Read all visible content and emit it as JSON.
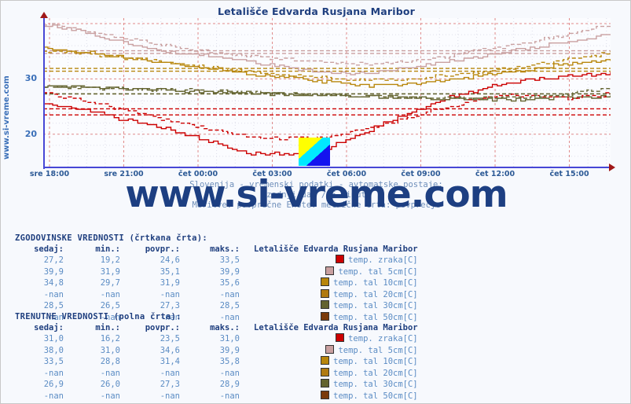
{
  "page": {
    "background": "#f7f9fd",
    "site_vertical_text": "www.si-vreme.com",
    "watermark": "www.si-vreme.com"
  },
  "chart_title": "Letališče Edvarda Rusjana Maribor",
  "subtitle": {
    "line1": "Slovenija - vremenski podatki - avtomatske postaje:",
    "line2": "zadnji dan / 5 minut",
    "line3": "Meritve: povprečne  Enote: metrične  Črta: povprečje"
  },
  "logo": {
    "name": "si-vreme-logo",
    "colors": [
      "#ffff00",
      "#00eaff",
      "#1414ef"
    ]
  },
  "chart_data": {
    "type": "line",
    "title": "Letališče Edvarda Rusjana Maribor",
    "xlabel": "",
    "ylabel": "",
    "ylim": [
      14,
      41
    ],
    "yticks": [
      20,
      30
    ],
    "grid": true,
    "legend_position": "bottom-table",
    "x": [
      "sre 18:00",
      "sre 21:00",
      "čet 00:00",
      "čet 03:00",
      "čet 06:00",
      "čet 09:00",
      "čet 12:00",
      "čet 15:00"
    ],
    "xtick_labels": [
      "sre 18:00",
      "sre 21:00",
      "čet 00:00",
      "čet 03:00",
      "čet 06:00",
      "čet 09:00",
      "čet 12:00",
      "čet 15:00"
    ],
    "series": [
      {
        "name": "temp. zraka[C]",
        "color": "#cc0000",
        "style": "solid",
        "group": "trenutne",
        "values": [
          25.8,
          24.4,
          22.6,
          21.0,
          19.0,
          16.6,
          16.4,
          17.6,
          20.6,
          23.8,
          26.6,
          28.6,
          30.0,
          30.6,
          31.0
        ]
      },
      {
        "name": "temp. tal  5cm[C]",
        "color": "#c9a0a0",
        "style": "solid",
        "group": "trenutne",
        "values": [
          39.8,
          38.4,
          36.6,
          35.0,
          34.2,
          33.2,
          32.0,
          31.2,
          31.0,
          32.0,
          33.2,
          34.4,
          35.6,
          36.8,
          38.0
        ]
      },
      {
        "name": "temp. tal 10cm[C]",
        "color": "#b8860b",
        "style": "solid",
        "group": "trenutne",
        "values": [
          35.6,
          34.8,
          34.0,
          33.0,
          32.0,
          31.0,
          30.2,
          29.4,
          28.8,
          29.0,
          29.8,
          30.8,
          31.8,
          32.8,
          33.5
        ]
      },
      {
        "name": "temp. tal 20cm[C]",
        "color": "#b07a10",
        "style": "solid",
        "group": "trenutne",
        "values": []
      },
      {
        "name": "temp. tal 30cm[C]",
        "color": "#63632f",
        "style": "solid",
        "group": "trenutne",
        "values": [
          28.6,
          28.6,
          28.4,
          28.0,
          27.6,
          27.4,
          27.2,
          27.0,
          26.8,
          26.6,
          26.4,
          26.3,
          26.4,
          26.6,
          26.9
        ]
      },
      {
        "name": "temp. tal 50cm[C]",
        "color": "#7a3a0a",
        "style": "solid",
        "group": "trenutne",
        "values": []
      },
      {
        "name": "temp. zraka[C] (zgodovinske)",
        "color": "#cc0000",
        "style": "dashed",
        "group": "zgodovinske",
        "values": [
          27.6,
          26.0,
          24.4,
          22.6,
          21.0,
          19.8,
          19.2,
          19.4,
          21.0,
          23.0,
          25.0,
          26.8,
          27.0,
          26.6,
          27.2
        ]
      },
      {
        "name": "temp. tal  5cm[C] (zgodovinske)",
        "color": "#c9a0a0",
        "style": "dashed",
        "group": "zgodovinske",
        "values": [
          39.9,
          38.8,
          37.4,
          36.0,
          35.0,
          34.2,
          33.6,
          33.0,
          32.6,
          33.2,
          34.2,
          35.4,
          36.6,
          38.2,
          39.9
        ]
      },
      {
        "name": "temp. tal 10cm[C] (zgodovinske)",
        "color": "#b8860b",
        "style": "dashed",
        "group": "zgodovinske",
        "values": [
          35.2,
          34.6,
          33.8,
          33.0,
          32.2,
          31.4,
          30.8,
          30.2,
          29.7,
          30.0,
          30.6,
          31.4,
          32.4,
          33.6,
          34.8
        ]
      },
      {
        "name": "temp. tal 30cm[C] (zgodovinske)",
        "color": "#63632f",
        "style": "dashed",
        "group": "zgodovinske",
        "values": [
          28.5,
          28.4,
          28.2,
          28.0,
          27.8,
          27.5,
          27.3,
          27.1,
          26.9,
          26.7,
          26.6,
          26.6,
          26.8,
          27.2,
          28.5
        ]
      }
    ]
  },
  "tables": [
    {
      "heading": "ZGODOVINSKE VREDNOSTI (črtkana črta):",
      "station": "Letališče Edvarda Rusjana Maribor",
      "columns": [
        "sedaj:",
        "min.:",
        "povpr.:",
        "maks.:"
      ],
      "rows": [
        {
          "sedaj": "27,2",
          "min": "19,2",
          "povpr": "24,6",
          "maks": "33,5",
          "color": "#cc0000",
          "series": "temp. zraka[C]"
        },
        {
          "sedaj": "39,9",
          "min": "31,9",
          "povpr": "35,1",
          "maks": "39,9",
          "color": "#c9a0a0",
          "series": "temp. tal  5cm[C]"
        },
        {
          "sedaj": "34,8",
          "min": "29,7",
          "povpr": "31,9",
          "maks": "35,6",
          "color": "#b8860b",
          "series": "temp. tal 10cm[C]"
        },
        {
          "sedaj": "-nan",
          "min": "-nan",
          "povpr": "-nan",
          "maks": "-nan",
          "color": "#b07a10",
          "series": "temp. tal 20cm[C]"
        },
        {
          "sedaj": "28,5",
          "min": "26,5",
          "povpr": "27,3",
          "maks": "28,5",
          "color": "#63632f",
          "series": "temp. tal 30cm[C]"
        },
        {
          "sedaj": "-nan",
          "min": "-nan",
          "povpr": "-nan",
          "maks": "-nan",
          "color": "#7a3a0a",
          "series": "temp. tal 50cm[C]"
        }
      ]
    },
    {
      "heading": "TRENUTNE VREDNOSTI (polna črta):",
      "station": "Letališče Edvarda Rusjana Maribor",
      "columns": [
        "sedaj:",
        "min.:",
        "povpr.:",
        "maks.:"
      ],
      "rows": [
        {
          "sedaj": "31,0",
          "min": "16,2",
          "povpr": "23,5",
          "maks": "31,0",
          "color": "#cc0000",
          "series": "temp. zraka[C]"
        },
        {
          "sedaj": "38,0",
          "min": "31,0",
          "povpr": "34,6",
          "maks": "39,9",
          "color": "#c9a0a0",
          "series": "temp. tal  5cm[C]"
        },
        {
          "sedaj": "33,5",
          "min": "28,8",
          "povpr": "31,4",
          "maks": "35,8",
          "color": "#b8860b",
          "series": "temp. tal 10cm[C]"
        },
        {
          "sedaj": "-nan",
          "min": "-nan",
          "povpr": "-nan",
          "maks": "-nan",
          "color": "#b07a10",
          "series": "temp. tal 20cm[C]"
        },
        {
          "sedaj": "26,9",
          "min": "26,0",
          "povpr": "27,3",
          "maks": "28,9",
          "color": "#63632f",
          "series": "temp. tal 30cm[C]"
        },
        {
          "sedaj": "-nan",
          "min": "-nan",
          "povpr": "-nan",
          "maks": "-nan",
          "color": "#7a3a0a",
          "series": "temp. tal 50cm[C]"
        }
      ]
    }
  ]
}
